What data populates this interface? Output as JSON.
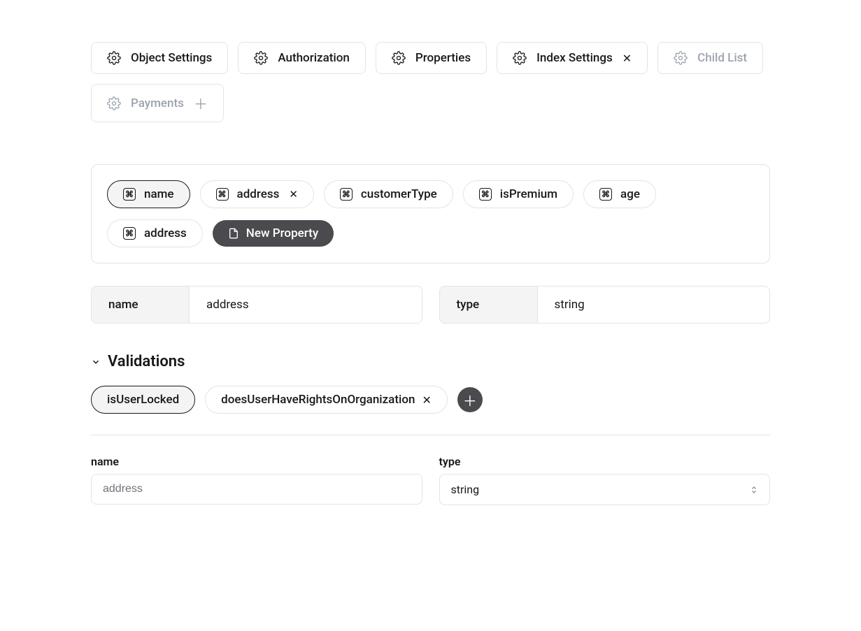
{
  "tabs": [
    {
      "label": "Object Settings",
      "muted": false
    },
    {
      "label": "Authorization",
      "muted": false
    },
    {
      "label": "Properties",
      "muted": false
    },
    {
      "label": "Index Settings",
      "muted": false,
      "close": true
    },
    {
      "label": "Child List",
      "muted": true
    },
    {
      "label": "Payments",
      "muted": true,
      "plus": true
    }
  ],
  "properties": {
    "row1": [
      {
        "label": "name",
        "selected": true
      },
      {
        "label": "address",
        "close": true
      },
      {
        "label": "customerType"
      },
      {
        "label": "isPremium"
      },
      {
        "label": "age"
      }
    ],
    "row2": [
      {
        "label": "address"
      }
    ],
    "newProperty": "New Property"
  },
  "fields": {
    "nameLabel": "name",
    "nameValue": "address",
    "typeLabel": "type",
    "typeValue": "string"
  },
  "validations": {
    "title": "Validations",
    "items": [
      {
        "label": "isUserLocked",
        "selected": true
      },
      {
        "label": "doesUserHaveRightsOnOrganization",
        "close": true
      }
    ]
  },
  "form": {
    "nameLabel": "name",
    "nameValue": "address",
    "typeLabel": "type",
    "typeValue": "string"
  }
}
